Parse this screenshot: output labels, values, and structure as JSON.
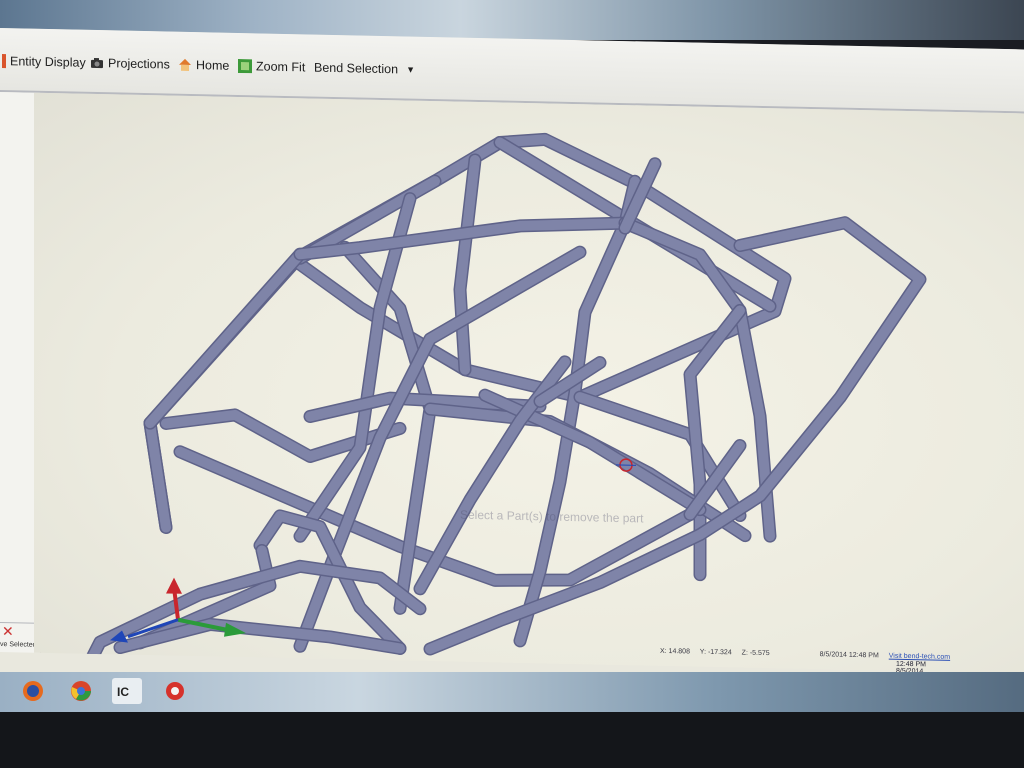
{
  "toolbar": {
    "entity_display": "Entity Display",
    "projections": "Projections",
    "home": "Home",
    "zoom_fit": "Zoom Fit",
    "bend_selection": "Bend Selection"
  },
  "left_panel": {
    "remove_label": "ve Selected"
  },
  "viewport": {
    "hint": "Select a Part(s) to remove the part"
  },
  "status": {
    "x": "X: 14.808",
    "y": "Y: -17.324",
    "z": "Z: -5.575",
    "date_time": "8/5/2014 12:48 PM",
    "link": "Visit bend-tech.com"
  },
  "tray": {
    "time": "12:48 PM",
    "date": "8/5/2014"
  },
  "colors": {
    "tube": "#7f84a8",
    "tube_dark": "#5f6389",
    "axis_x": "#2b9b3a",
    "axis_y": "#c9262d",
    "axis_z": "#1f46b8"
  }
}
